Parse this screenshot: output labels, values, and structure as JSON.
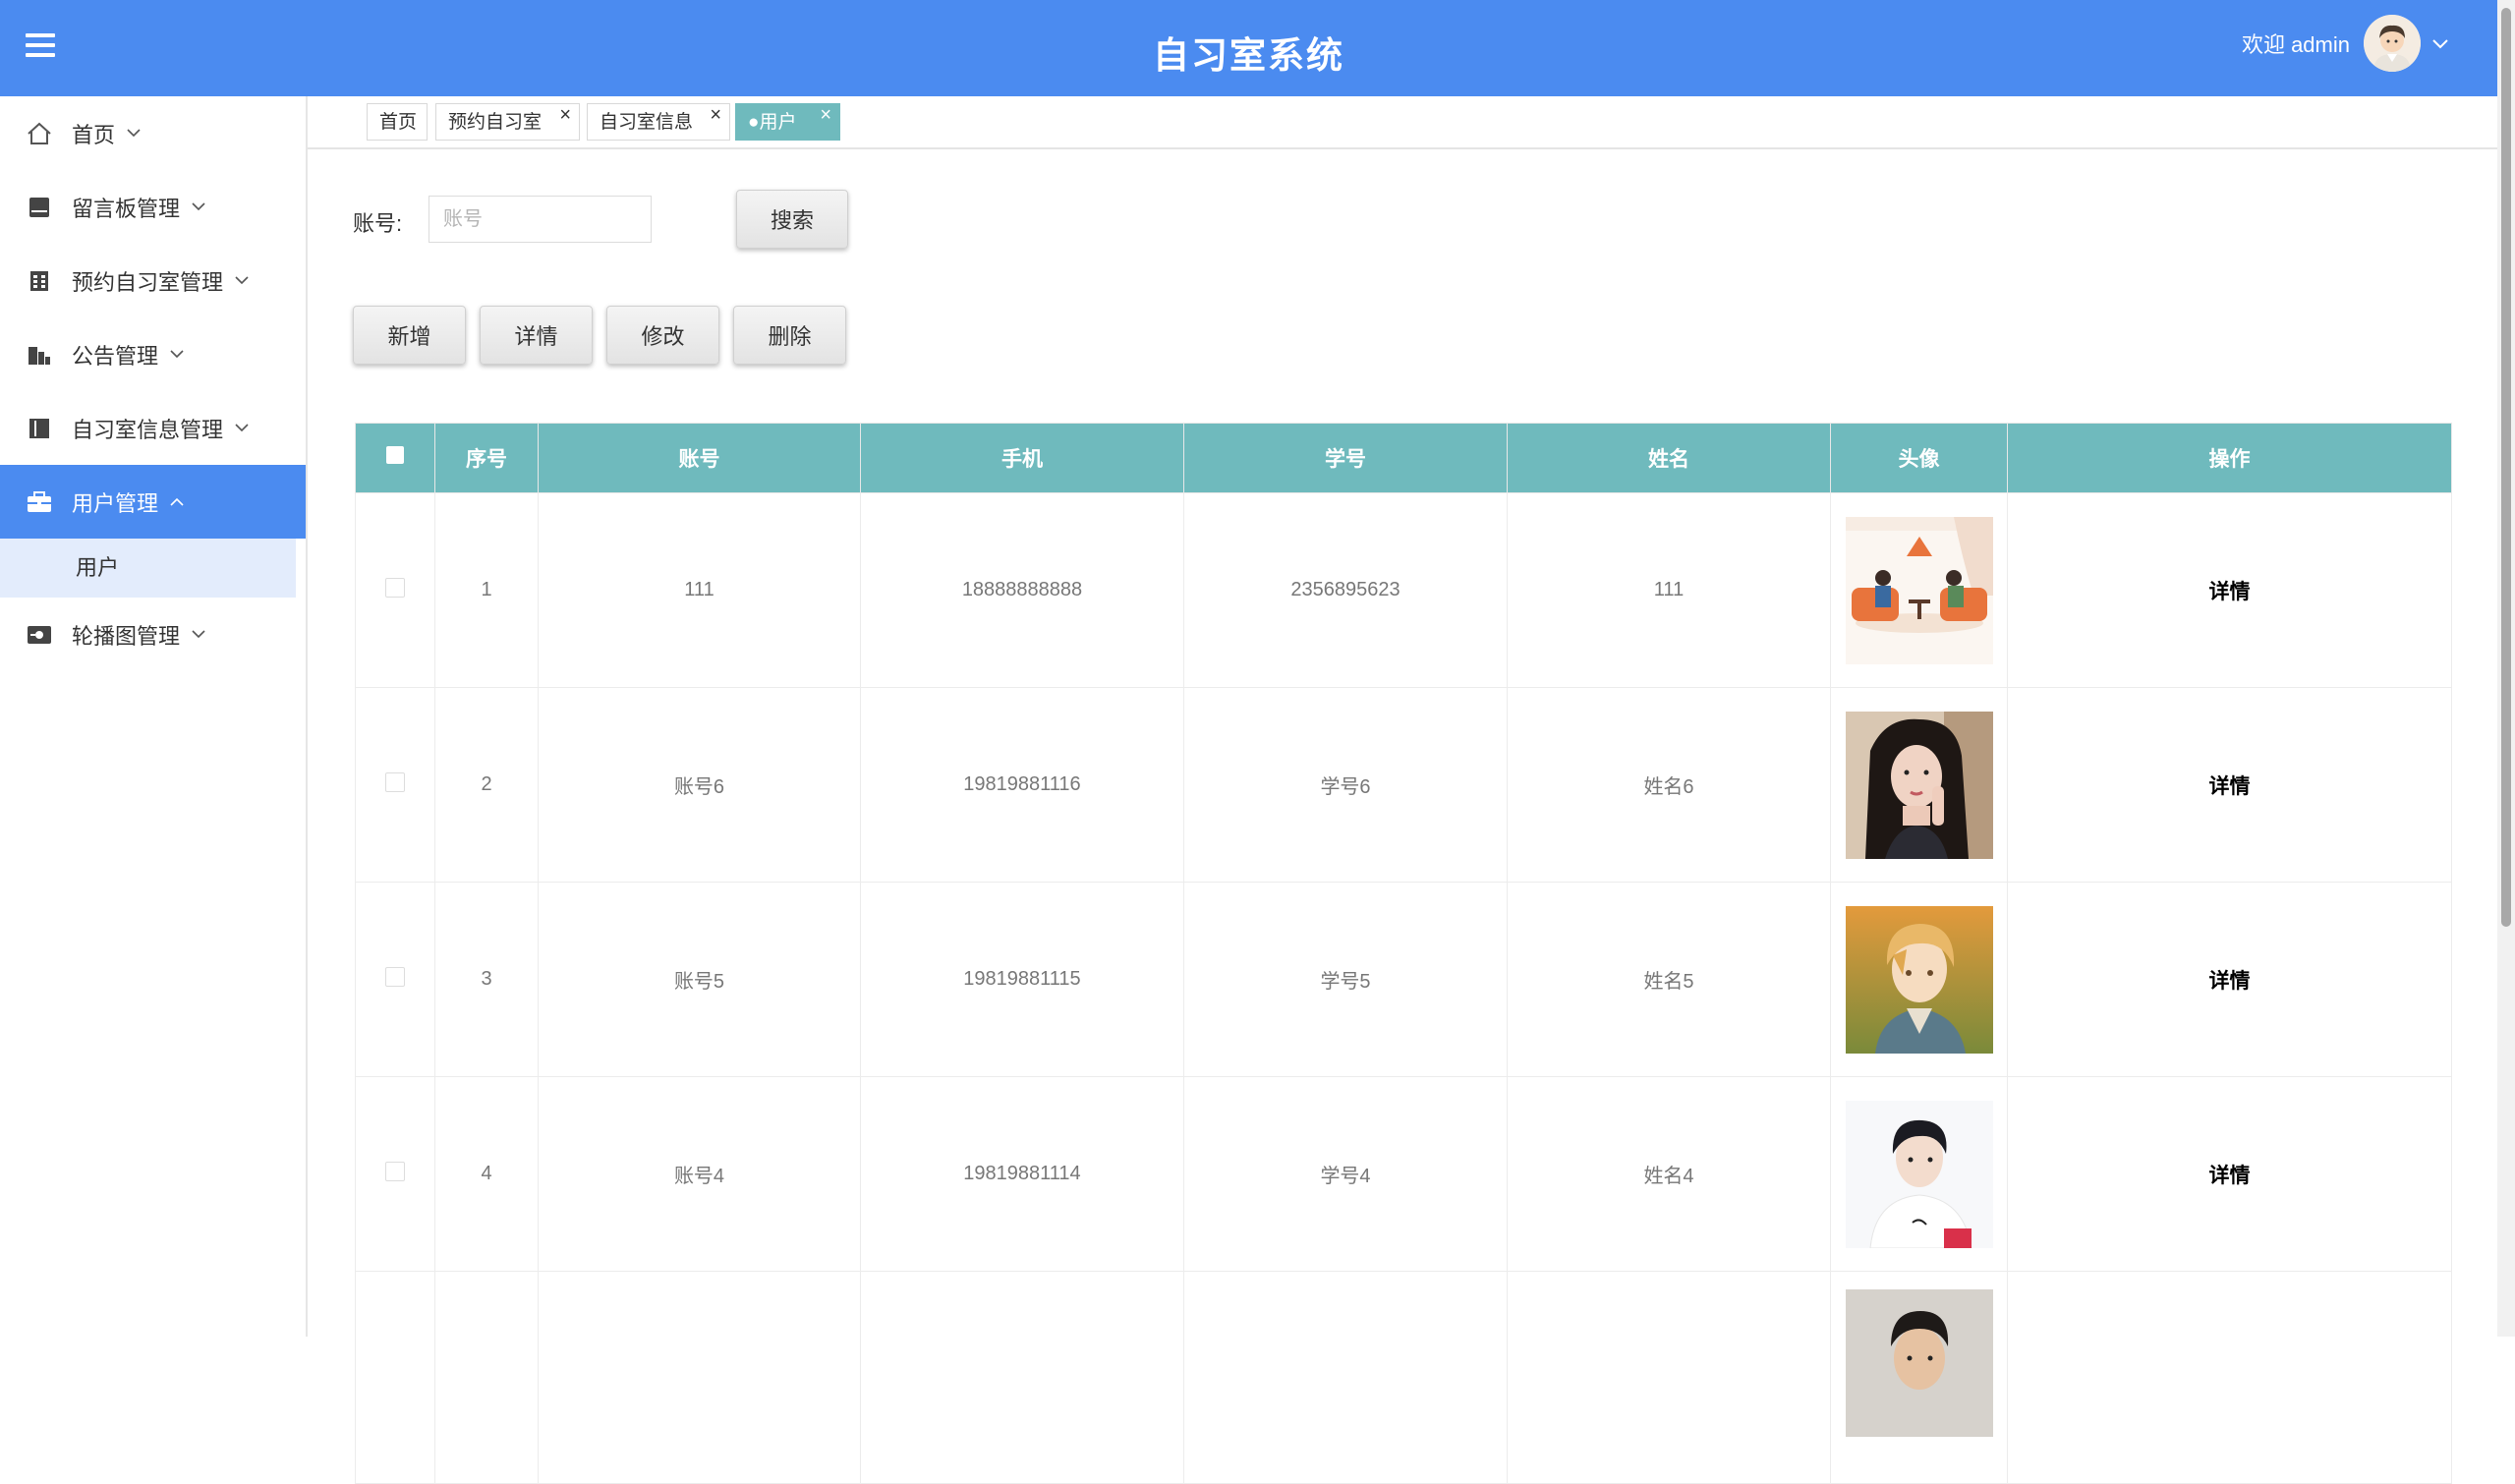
{
  "header": {
    "title": "自习室系统",
    "welcome": "欢迎 admin"
  },
  "sidebar": {
    "items": [
      {
        "label": "首页",
        "icon": "home-icon",
        "expanded": false
      },
      {
        "label": "留言板管理",
        "icon": "message-board-icon",
        "expanded": false
      },
      {
        "label": "预约自习室管理",
        "icon": "calendar-icon",
        "expanded": false
      },
      {
        "label": "公告管理",
        "icon": "announcement-icon",
        "expanded": false
      },
      {
        "label": "自习室信息管理",
        "icon": "room-info-icon",
        "expanded": false
      },
      {
        "label": "用户管理",
        "icon": "briefcase-icon",
        "expanded": true,
        "active": true
      },
      {
        "label": "轮播图管理",
        "icon": "carousel-icon",
        "expanded": false
      }
    ],
    "sub_items": [
      {
        "label": "用户"
      }
    ]
  },
  "tabs": [
    {
      "label": "首页",
      "closable": false
    },
    {
      "label": "预约自习室",
      "closable": true
    },
    {
      "label": "自习室信息",
      "closable": true
    },
    {
      "label": "●用户",
      "closable": true,
      "active": true
    }
  ],
  "search": {
    "label": "账号:",
    "placeholder": "账号",
    "button": "搜索"
  },
  "actions": {
    "add": "新增",
    "detail": "详情",
    "edit": "修改",
    "delete": "删除"
  },
  "table": {
    "columns": [
      "序号",
      "账号",
      "手机",
      "学号",
      "姓名",
      "头像",
      "操作"
    ],
    "rows": [
      {
        "index": "1",
        "account": "111",
        "phone": "18888888888",
        "student_no": "2356895623",
        "name": "111",
        "avatar": "cartoon-people-sofa-image",
        "action": "详情"
      },
      {
        "index": "2",
        "account": "账号6",
        "phone": "19819881116",
        "student_no": "学号6",
        "name": "姓名6",
        "avatar": "woman-portrait-image",
        "action": "详情"
      },
      {
        "index": "3",
        "account": "账号5",
        "phone": "19819881115",
        "student_no": "学号5",
        "name": "姓名5",
        "avatar": "anime-boy-image",
        "action": "详情"
      },
      {
        "index": "4",
        "account": "账号4",
        "phone": "19819881114",
        "student_no": "学号4",
        "name": "姓名4",
        "avatar": "young-man-portrait-image",
        "action": "详情"
      },
      {
        "index": "",
        "account": "",
        "phone": "",
        "student_no": "",
        "name": "",
        "avatar": "man-portrait-image",
        "action": ""
      }
    ]
  },
  "colors": {
    "header_bg": "#4b8bf0",
    "table_header_bg": "#6fbabd",
    "active_nav_bg": "#4b8bf0",
    "submenu_bg": "#e3ecfc"
  }
}
